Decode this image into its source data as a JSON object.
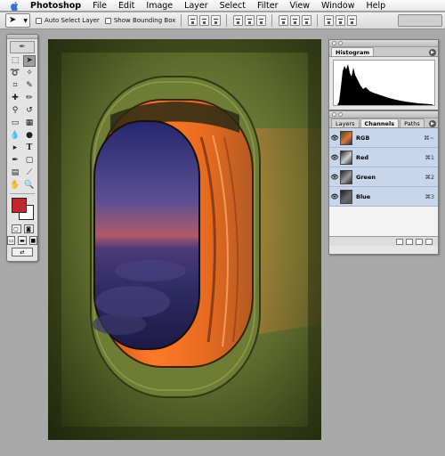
{
  "menubar": {
    "app": "Photoshop",
    "items": [
      "File",
      "Edit",
      "Image",
      "Layer",
      "Select",
      "Filter",
      "View",
      "Window",
      "Help"
    ]
  },
  "options": {
    "auto_select_label": "Auto Select Layer",
    "show_bounding_label": "Show Bounding Box"
  },
  "toolbox": {
    "foreground_color": "#c0282d",
    "background_color": "#ffffff"
  },
  "histogram": {
    "tab": "Histogram"
  },
  "channels_panel": {
    "tabs": [
      "Layers",
      "Channels",
      "Paths"
    ],
    "active_tab": "Channels",
    "channels": [
      {
        "name": "RGB",
        "shortcut": "⌘~"
      },
      {
        "name": "Red",
        "shortcut": "⌘1"
      },
      {
        "name": "Green",
        "shortcut": "⌘2"
      },
      {
        "name": "Blue",
        "shortcut": "⌘3"
      }
    ]
  },
  "colors": {
    "selection": "#c7d6ea",
    "panel_bg": "#e6e6e6",
    "workspace": "#a9a9a9"
  }
}
